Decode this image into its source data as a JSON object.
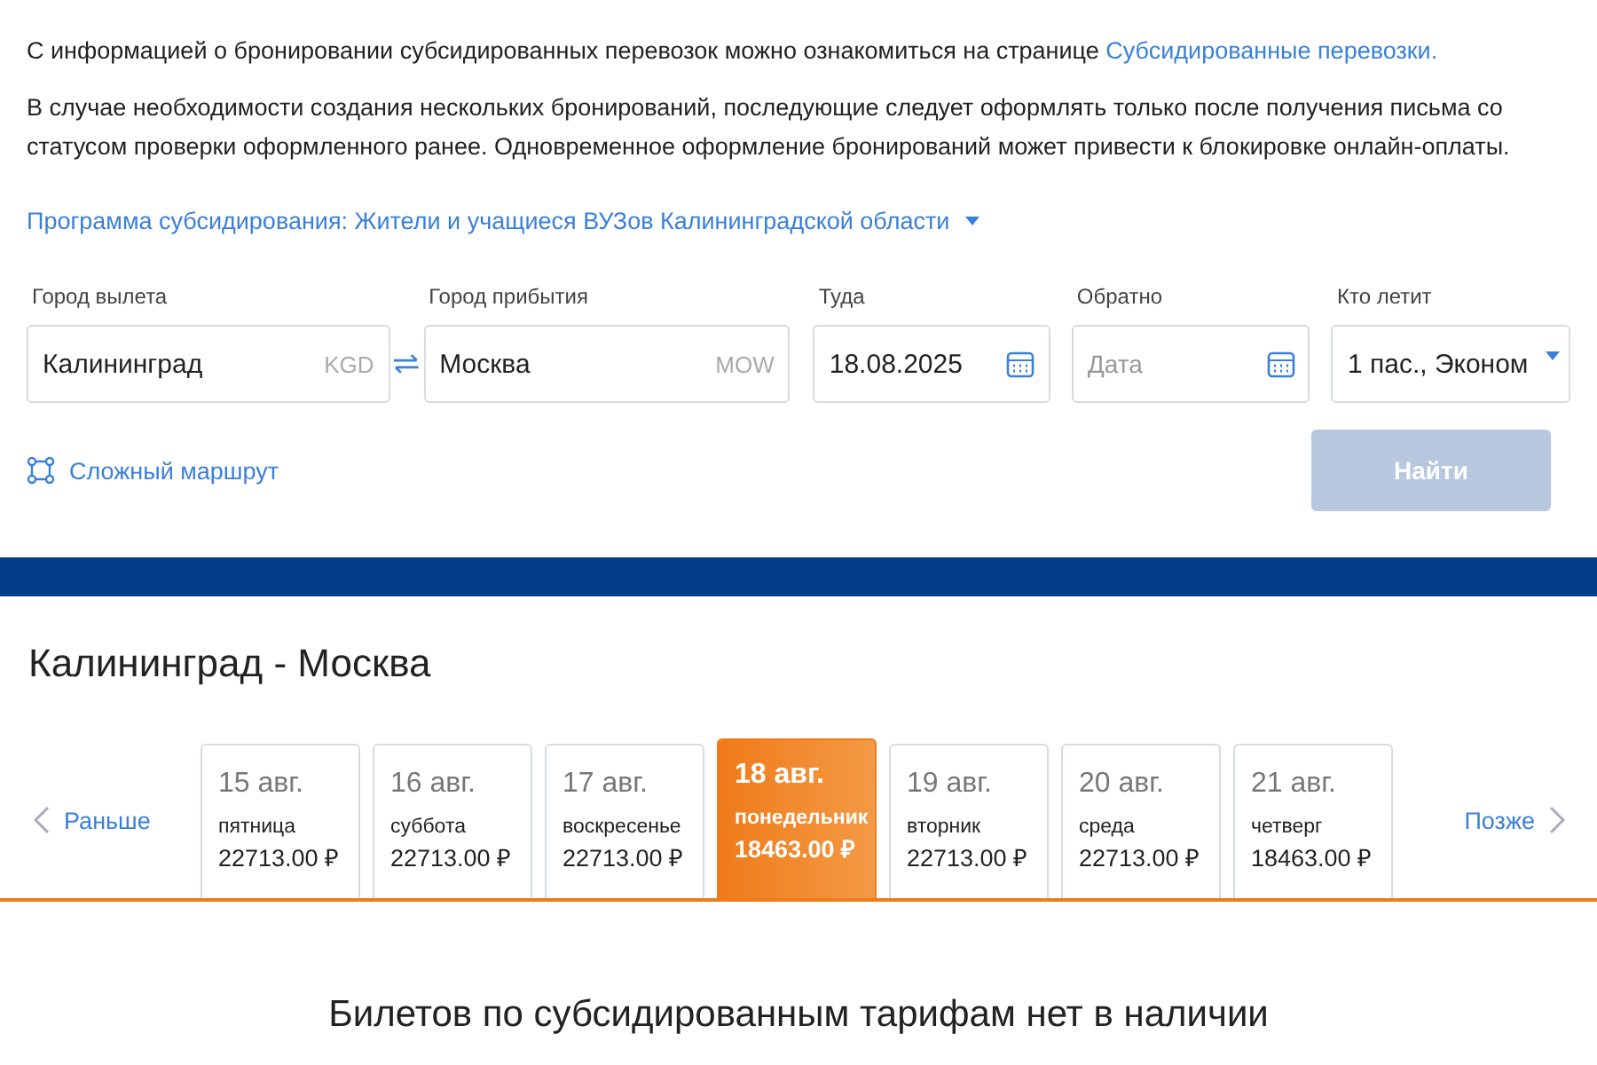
{
  "info": {
    "text": "С информацией о бронировании субсидированных перевозок можно ознакомиться на странице ",
    "link": "Субсидированные перевозки."
  },
  "notice": "В случае необходимости создания нескольких бронирований, последующие следует оформлять только после получения письма со статусом проверки оформленного ранее. Одновременное оформление бронирований может привести к блокировке онлайн-оплаты.",
  "program": {
    "label": "Программа субсидирования: Жители и учащиеся ВУЗов Калининградской области",
    "expanded": false
  },
  "search": {
    "from": {
      "label": "Город вылета",
      "value": "Калининград",
      "code": "KGD"
    },
    "to": {
      "label": "Город прибытия",
      "value": "Москва",
      "code": "MOW"
    },
    "depart": {
      "label": "Туда",
      "value": "18.08.2025"
    },
    "return": {
      "label": "Обратно",
      "placeholder": "Дата"
    },
    "passengers": {
      "label": "Кто летит",
      "value": "1 пас., Эконом"
    },
    "complex_route": "Сложный маршрут",
    "find_button": {
      "label": "Найти",
      "disabled": true
    }
  },
  "route_title": "Калининград - Москва",
  "dates": {
    "prev": "Раньше",
    "next": "Позже",
    "items": [
      {
        "date": "15 авг.",
        "weekday": "пятница",
        "price": "22713.00 ₽",
        "selected": false
      },
      {
        "date": "16 авг.",
        "weekday": "суббота",
        "price": "22713.00 ₽",
        "selected": false
      },
      {
        "date": "17 авг.",
        "weekday": "воскресенье",
        "price": "22713.00 ₽",
        "selected": false
      },
      {
        "date": "18 авг.",
        "weekday": "понедельник",
        "price": "18463.00 ₽",
        "selected": true
      },
      {
        "date": "19 авг.",
        "weekday": "вторник",
        "price": "22713.00 ₽",
        "selected": false
      },
      {
        "date": "20 авг.",
        "weekday": "среда",
        "price": "22713.00 ₽",
        "selected": false
      },
      {
        "date": "21 авг.",
        "weekday": "четверг",
        "price": "18463.00 ₽",
        "selected": false
      }
    ]
  },
  "empty_message": "Билетов по субсидированным тарифам нет в наличии"
}
